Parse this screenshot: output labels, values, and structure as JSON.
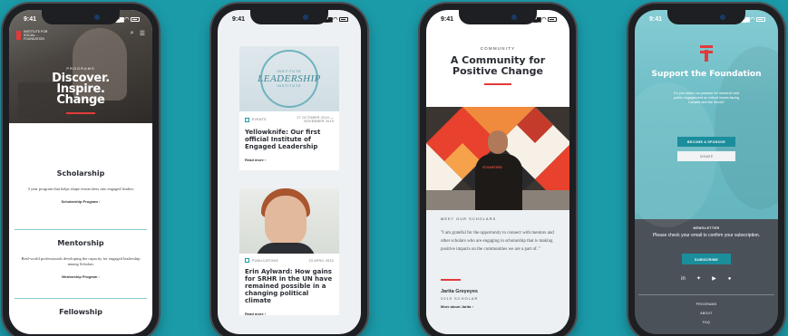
{
  "status": {
    "time": "9:41"
  },
  "phone1": {
    "logo_text": "INSTITUTE FOR SOCIAL ... FOUNDATION",
    "kicker": "PROGRAMS",
    "title_lines": [
      "Discover.",
      "Inspire.",
      "Change"
    ],
    "sections": [
      {
        "heading": "Scholarship",
        "desc": "3 year program that helps shape researchers into engaged leaders",
        "link": "Scholarship Program"
      },
      {
        "heading": "Mentorship",
        "desc": "Real-world professionals developing the capacity for engaged leadership among Scholars",
        "link": "Mentorship Program"
      },
      {
        "heading": "Fellowship"
      }
    ]
  },
  "phone2": {
    "cards": [
      {
        "badge_top": "INSTITUTE",
        "badge_main": "LEADERSHIP",
        "badge_bottom": "INSTITUTE",
        "category": "EVENTS",
        "date": "27 OCTOBER 2019 — NOVEMBER 2019",
        "title": "Yellowknife: Our first official Institute of Engaged Leadership",
        "read_more": "Read more"
      },
      {
        "category": "PUBLICATIONS",
        "date": "23 APRIL 2020",
        "title": "Erin Aylward: How gains for SRHR in the UN have remained possible in a changing political climate",
        "read_more": "Read more"
      }
    ]
  },
  "phone3": {
    "kicker": "COMMUNITY",
    "title_lines": [
      "A Community for",
      "Positive Change"
    ],
    "shirt_text": "STANFORD",
    "meet_label": "MEET OUR SCHOLARS",
    "quote": "\"I am grateful for the opportunity to connect with mentors and other scholars who are engaging in scholarship that is making positive impacts on the communities we are a part of. \"",
    "name": "Jarita Greyeyes",
    "role": "2019 SCHOLAR",
    "more_link": "More about Jarita"
  },
  "phone4": {
    "title": "Support the Foundation",
    "text": "Do you share our passion for research and public engagement on critical issues facing Canada and the World?",
    "btn_sponsor": "BECOME A SPONSOR",
    "btn_donate": "DONATE",
    "newsletter_label": "NEWSLETTER",
    "newsletter_text": "Please check your email to confirm your subscription.",
    "subscribe": "SUBSCRIBE",
    "social_icons": [
      "linkedin-icon",
      "twitter-icon",
      "youtube-icon",
      "facebook-icon"
    ],
    "footer_links": [
      "PROGRAMS",
      "ABOUT",
      "FAQ"
    ]
  }
}
